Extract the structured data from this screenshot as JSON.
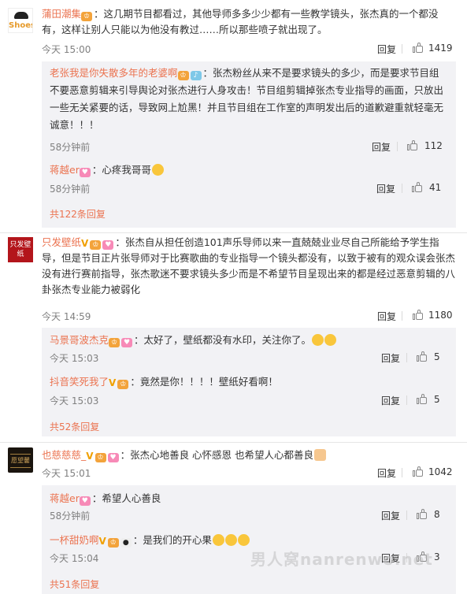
{
  "comments": [
    {
      "avatar_text": "Shoes",
      "username": "蒲田潮集",
      "text": "：这几期节目都看过，其他导师多多少少都有一些教学镜头，张杰真的一个都没有，这样让别人只能以为他没有教过……所以那些喷子就出现了。",
      "time": "今天 15:00",
      "reply_label": "回复",
      "likes": "1419",
      "replies": [
        {
          "username": "老张我是你失散多年的老婆啊",
          "text": "：张杰粉丝从来不是要求镜头的多少，而是要求节目组不要恶意剪辑来引导舆论对张杰进行人身攻击！节目组剪辑掉张杰专业指导的画面，只放出一些无关紧要的话，导致网上尬黑！并且节目组在工作室的声明发出后的道歉避重就轻毫无诚意！！！",
          "time": "58分钟前",
          "reply_label": "回复",
          "likes": "112"
        },
        {
          "username": "蒋越er",
          "text": "：心疼我哥哥",
          "time": "58分钟前",
          "reply_label": "回复",
          "likes": "41"
        }
      ],
      "more": "共122条回复"
    },
    {
      "avatar_text": "只发壁纸",
      "username": "只发壁纸",
      "text": "：张杰自从担任创造101声乐导师以来一直兢兢业业尽自己所能给予学生指导，但是节目正片张导师对于比赛歌曲的专业指导一个镜头都没有，以致于被有的观众误会张杰没有进行赛前指导，张杰歌迷不要求镜头多少而是不希望节目呈现出来的都是经过恶意剪辑的八卦张杰专业能力被弱化",
      "time": "今天 14:59",
      "reply_label": "回复",
      "likes": "1180",
      "replies": [
        {
          "username": "马景哥波杰克",
          "text": "：太好了，壁纸都没有水印，关注你了。",
          "time": "今天 15:03",
          "reply_label": "回复",
          "likes": "5"
        },
        {
          "username": "抖音笑死我了",
          "text": "：竟然是你！！！！壁纸好看啊！",
          "time": "今天 15:03",
          "reply_label": "回复",
          "likes": "5"
        }
      ],
      "more": "共52条回复"
    },
    {
      "avatar_text": "愿望馨",
      "username": "也慈慈慈_",
      "text": "：张杰心地善良 心怀感恩 也希望人心都善良",
      "time": "今天 15:01",
      "reply_label": "回复",
      "likes": "1042",
      "replies": [
        {
          "username": "蒋越er",
          "text": "：希望人心善良",
          "time": "58分钟前",
          "reply_label": "回复",
          "likes": "8"
        },
        {
          "username": "一杯甜奶啊",
          "text": "：是我们的开心果",
          "time": "今天 15:04",
          "reply_label": "回复",
          "likes": "3"
        }
      ],
      "more": "共51条回复"
    }
  ],
  "watermark": "男人窝nanrenwo.net",
  "colors": {
    "username": "#eb7350",
    "meta": "#808080",
    "reply_bg": "#f2f2f5"
  }
}
